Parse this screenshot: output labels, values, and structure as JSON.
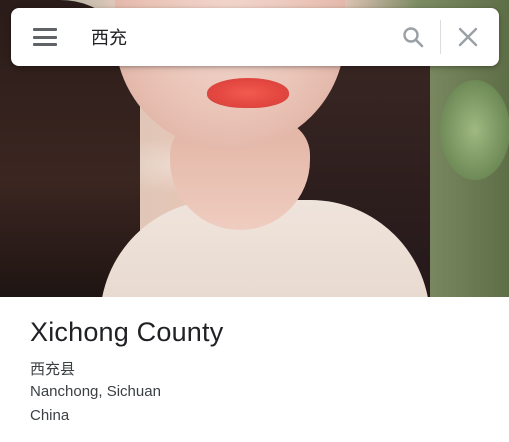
{
  "search": {
    "query": "西充",
    "icons": {
      "menu": "menu-icon",
      "search": "search-icon",
      "clear": "close-icon"
    }
  },
  "photo": {
    "description_icon": "place-photo"
  },
  "place": {
    "title": "Xichong County",
    "local_name": "西充县",
    "region": "Nanchong, Sichuan",
    "country": "China"
  },
  "colors": {
    "icon_gray": "#5f6368",
    "icon_light": "#9aa0a6",
    "title_text": "#202124",
    "body_text": "#3c4043"
  }
}
